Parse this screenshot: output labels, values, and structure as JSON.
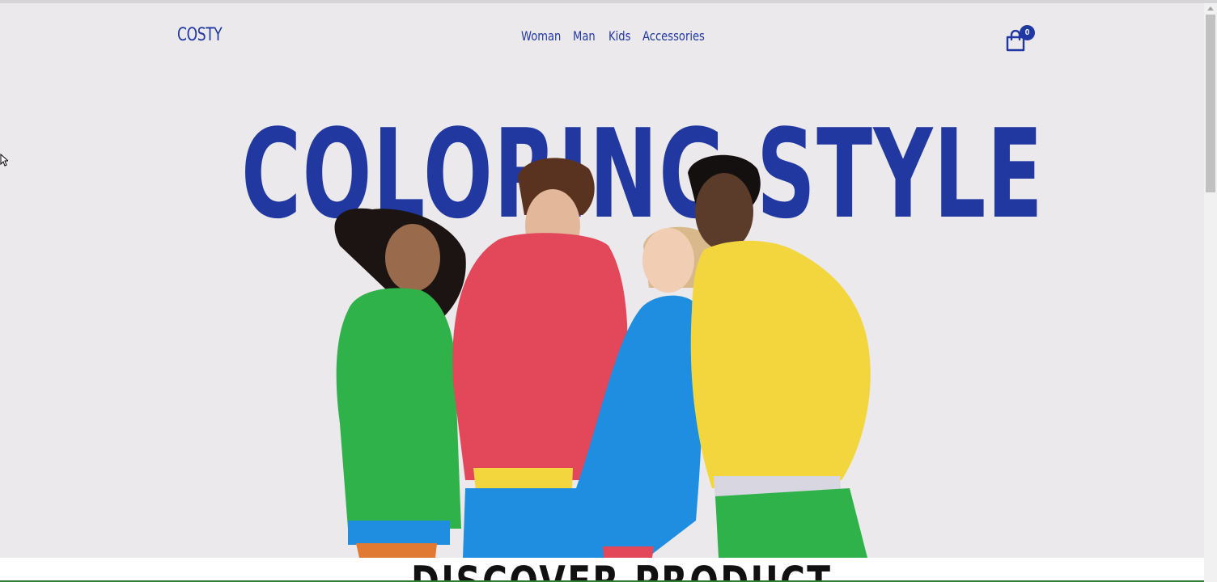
{
  "header": {
    "logo": "COSTY",
    "nav": [
      {
        "label": "Woman"
      },
      {
        "label": "Man"
      },
      {
        "label": "Kids"
      },
      {
        "label": "Accessories"
      }
    ],
    "cart_count": "0",
    "cart_icon": "shopping-bag-icon"
  },
  "hero": {
    "title": "COLORING STYLE"
  },
  "section": {
    "heading": "DISCOVER PRODUCT"
  },
  "colors": {
    "brand": "#1f38a3",
    "background": "#ece9ec",
    "green_hoodie": "#2fb24a",
    "red_hoodie": "#e2475a",
    "blue_hoodie": "#1f8ee0",
    "yellow_hoodie": "#f3d63e"
  }
}
